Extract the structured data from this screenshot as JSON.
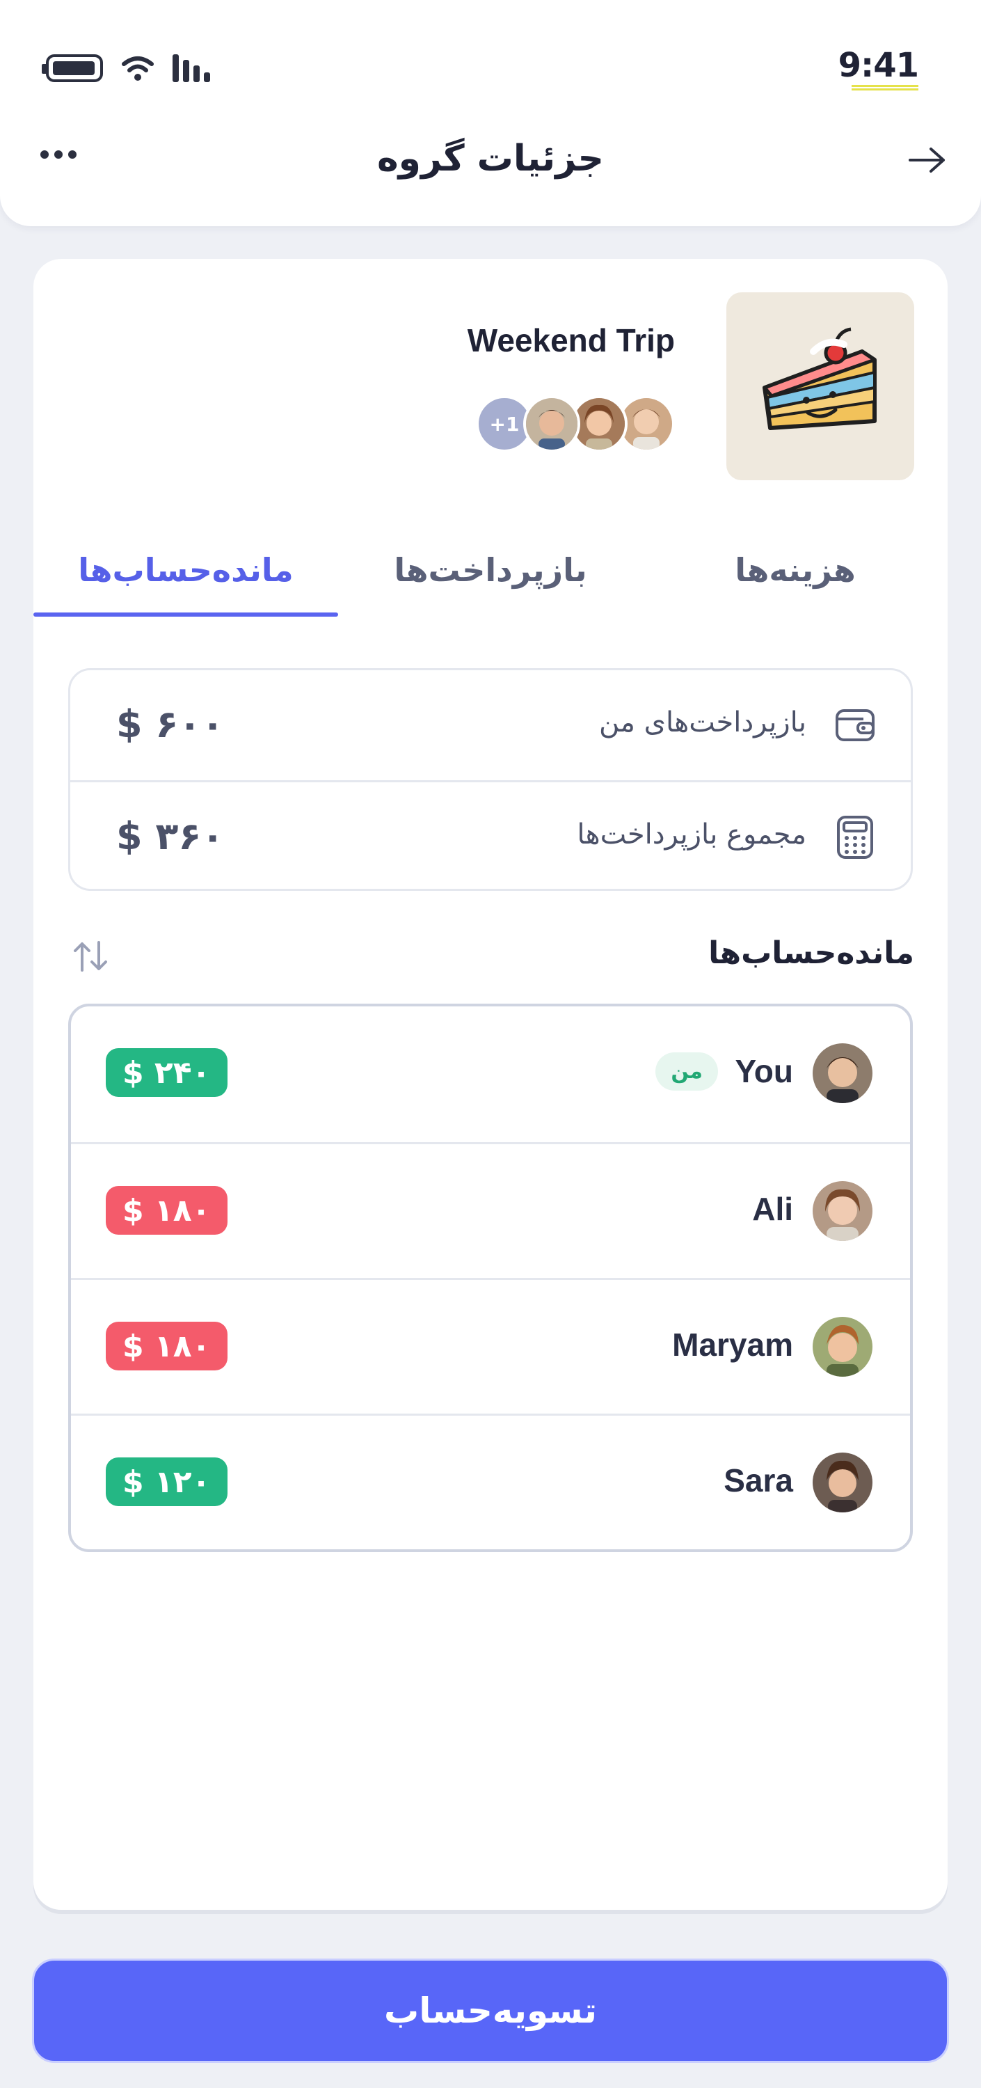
{
  "status_bar": {
    "time": "9:41"
  },
  "nav": {
    "title": "جزئیات گروه"
  },
  "group": {
    "name": "Weekend Trip",
    "extra_members": "+1"
  },
  "tabs": [
    {
      "label": "هزینه‌ها",
      "active": false
    },
    {
      "label": "بازپرداخت‌ها",
      "active": false
    },
    {
      "label": "مانده‌حساب‌ها",
      "active": true
    }
  ],
  "summary": [
    {
      "label": "بازپرداخت‌های من",
      "value": "$ ۶۰۰",
      "icon": "wallet-icon"
    },
    {
      "label": "مجموع بازپرداخت‌ها",
      "value": "$ ۳۶۰",
      "icon": "calculator-icon"
    }
  ],
  "balances_section": {
    "title": "مانده‌حساب‌ها"
  },
  "balances": [
    {
      "name": "You",
      "badge": "من",
      "amount": "$ ۲۴۰",
      "status": "positive"
    },
    {
      "name": "Ali",
      "badge": "",
      "amount": "$ ۱۸۰",
      "status": "negative"
    },
    {
      "name": "Maryam",
      "badge": "",
      "amount": "$ ۱۸۰",
      "status": "negative"
    },
    {
      "name": "Sara",
      "badge": "",
      "amount": "$ ۱۲۰",
      "status": "positive"
    }
  ],
  "actions": {
    "settle_label": "تسویه‌حساب"
  },
  "colors": {
    "accent": "#5866f8",
    "positive": "#24b784",
    "negative": "#f45b6b",
    "background": "#eef0f5"
  }
}
